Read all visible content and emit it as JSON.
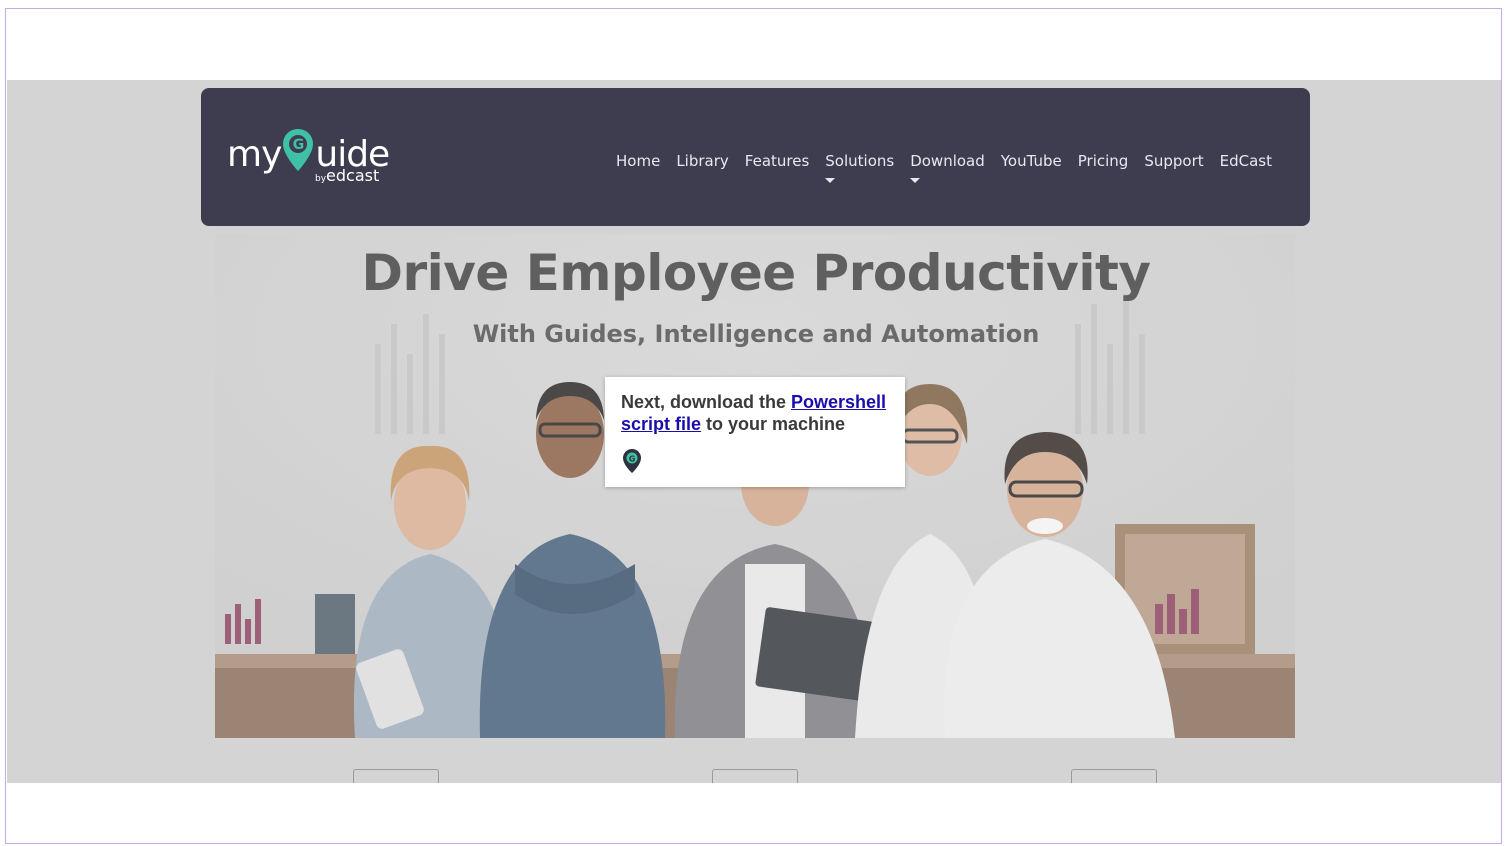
{
  "brand": {
    "logo_prefix": "my",
    "logo_suffix": "uide",
    "logo_pin_letter": "G",
    "logo_by": "by",
    "logo_company": "edcast",
    "accent_color": "#3fc1a5",
    "navbar_color": "#3e3d50"
  },
  "nav": {
    "items": [
      {
        "label": "Home",
        "has_dropdown": false
      },
      {
        "label": "Library",
        "has_dropdown": false
      },
      {
        "label": "Features",
        "has_dropdown": false
      },
      {
        "label": "Solutions",
        "has_dropdown": true
      },
      {
        "label": "Download",
        "has_dropdown": true
      },
      {
        "label": "YouTube",
        "has_dropdown": false
      },
      {
        "label": "Pricing",
        "has_dropdown": false
      },
      {
        "label": "Support",
        "has_dropdown": false
      },
      {
        "label": "EdCast",
        "has_dropdown": false
      }
    ]
  },
  "hero": {
    "headline": "Drive Employee Productivity",
    "subheadline": "With Guides, Intelligence and Automation",
    "image_icon": "team-photo-image"
  },
  "tooltip": {
    "text_before": "Next, download the ",
    "link_text_1": "Powershell",
    "link_text_2": "script file",
    "text_after": " to your machine",
    "pin_letter": "G",
    "pin_icon": "myguide-pin-icon"
  }
}
